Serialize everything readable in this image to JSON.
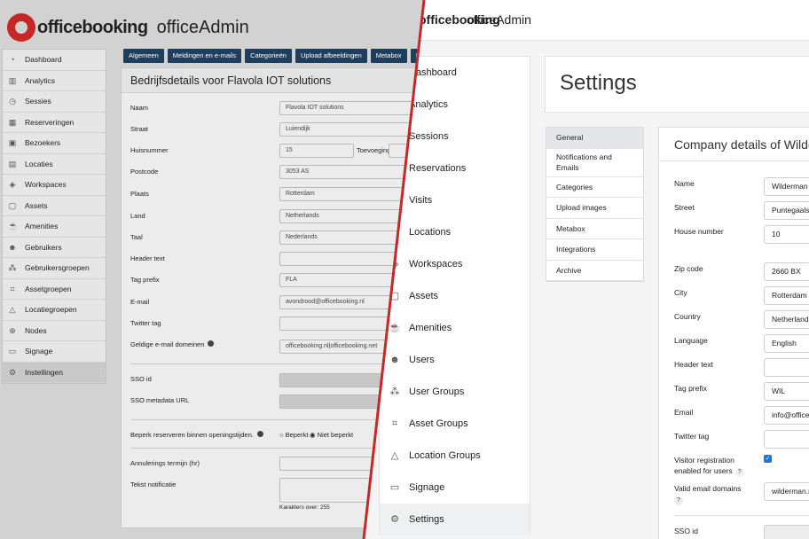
{
  "colors": {
    "accent_red": "#c62828",
    "old_tab_bg": "#1f3d5c",
    "checkbox_blue": "#1a73e8"
  },
  "old": {
    "brand": {
      "name": "officebooking",
      "app": "officeAdmin"
    },
    "sidebar": [
      {
        "label": "Dashboard",
        "icon": "speedometer-icon"
      },
      {
        "label": "Analytics",
        "icon": "chart-icon"
      },
      {
        "label": "Sessies",
        "icon": "clock-icon"
      },
      {
        "label": "Reserveringen",
        "icon": "calendar-icon"
      },
      {
        "label": "Bezoekers",
        "icon": "badge-icon"
      },
      {
        "label": "Locaties",
        "icon": "building-icon"
      },
      {
        "label": "Workspaces",
        "icon": "layers-icon"
      },
      {
        "label": "Assets",
        "icon": "cube-icon"
      },
      {
        "label": "Amenities",
        "icon": "cup-icon"
      },
      {
        "label": "Gebruikers",
        "icon": "users-icon"
      },
      {
        "label": "Gebruikersgroepen",
        "icon": "group-icon"
      },
      {
        "label": "Assetgroepen",
        "icon": "frame-icon"
      },
      {
        "label": "Locatiegroepen",
        "icon": "triangle-icon"
      },
      {
        "label": "Nodes",
        "icon": "node-icon"
      },
      {
        "label": "Signage",
        "icon": "screen-icon"
      },
      {
        "label": "Instellingen",
        "icon": "gear-icon"
      }
    ],
    "tabs": [
      "Algemeen",
      "Meldingen en e-mails",
      "Categorieën",
      "Upload afbeeldingen",
      "Metabox",
      "Integraties"
    ],
    "panel_title": "Bedrijfsdetails voor Flavola IOT solutions",
    "labels": {
      "naam": "Naam",
      "straat": "Straat",
      "huisnummer": "Huisnummer",
      "toevoeging": "Toevoeging",
      "postcode": "Postcode",
      "plaats": "Plaats",
      "land": "Land",
      "taal": "Taal",
      "header_text": "Header text",
      "tag_prefix": "Tag prefix",
      "email": "E-mail",
      "twitter_tag": "Twitter tag",
      "email_domains": "Geldige e-mail domeinen",
      "sso_id": "SSO id",
      "sso_metadata": "SSO metadata URL",
      "limit": "Beperk reserveren binnen openingstijden.",
      "beperkt": "Beperkt",
      "niet_beperkt": "Niet beperkt",
      "annulering": "Annulerings termijn (hr)",
      "tekst_notificatie": "Tekst notificatie",
      "karakters_over": "Karakters over: 255"
    },
    "values": {
      "naam": "Flavola IOT solutions",
      "straat": "Luiendijk",
      "huisnummer": "15",
      "postcode": "3053 AS",
      "plaats": "Rotterdam",
      "land": "Netherlands",
      "taal": "Nederlands",
      "tag_prefix": "FLA",
      "email": "avondrood@officebooking.nl",
      "email_domains": "officebooking.nl|officebooking.net"
    }
  },
  "new": {
    "brand": {
      "name": "officebooking",
      "app": "officeAdmin"
    },
    "sidebar": [
      {
        "label": "Dashboard",
        "icon": "speedometer-icon"
      },
      {
        "label": "Analytics",
        "icon": "chart-icon"
      },
      {
        "label": "Sessions",
        "icon": "clock-icon"
      },
      {
        "label": "Reservations",
        "icon": "calendar-icon"
      },
      {
        "label": "Visits",
        "icon": "badge-icon"
      },
      {
        "label": "Locations",
        "icon": "building-icon"
      },
      {
        "label": "Workspaces",
        "icon": "layers-icon"
      },
      {
        "label": "Assets",
        "icon": "cube-icon"
      },
      {
        "label": "Amenities",
        "icon": "cup-icon"
      },
      {
        "label": "Users",
        "icon": "users-icon"
      },
      {
        "label": "User Groups",
        "icon": "group-icon"
      },
      {
        "label": "Asset Groups",
        "icon": "frame-icon"
      },
      {
        "label": "Location Groups",
        "icon": "triangle-icon"
      },
      {
        "label": "Signage",
        "icon": "screen-icon"
      },
      {
        "label": "Settings",
        "icon": "gear-icon"
      }
    ],
    "settings_title": "Settings",
    "subnav": [
      "General",
      "Notifications and Emails",
      "Categories",
      "Upload images",
      "Metabox",
      "Integrations",
      "Archive"
    ],
    "company_title": "Company details of Wilderman",
    "labels": {
      "name": "Name",
      "street": "Street",
      "house_number": "House number",
      "zip": "Zip code",
      "city": "City",
      "country": "Country",
      "language": "Language",
      "header_text": "Header text",
      "tag_prefix": "Tag prefix",
      "email": "Email",
      "twitter_tag": "Twitter tag",
      "visitor_registration": "Visitor registration enabled for users",
      "valid_domains": "Valid email domains",
      "sso_id": "SSO id"
    },
    "values": {
      "name": "Wilderman",
      "street": "Puntegaalstraat",
      "house_number": "10",
      "zip": "2660 BX",
      "city": "Rotterdam",
      "country": "Netherlands",
      "language": "English",
      "tag_prefix": "WIL",
      "email": "info@officebooking.nl",
      "valid_domains": "wilderman.nl"
    },
    "help_mark": "?",
    "check_mark": "✓"
  }
}
